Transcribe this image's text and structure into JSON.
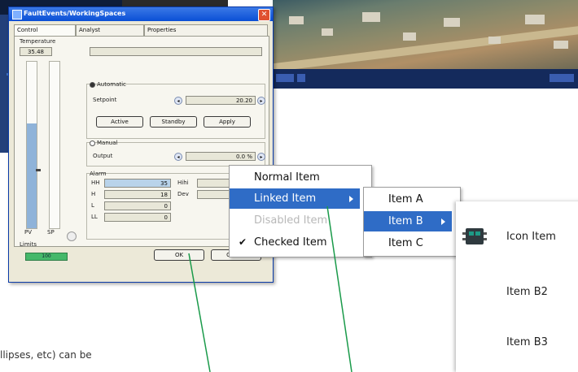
{
  "dialog": {
    "title": "FaultEvents/WorkingSpaces",
    "close_glyph": "✕",
    "tabs": [
      {
        "label": "Control"
      },
      {
        "label": "Analyst"
      },
      {
        "label": "Properties"
      }
    ],
    "temperature": {
      "label": "Temperature",
      "value": "35.48"
    },
    "automatic": {
      "label": "Automatic",
      "setpoint_label": "Setpoint",
      "setpoint_value": "20.20",
      "buttons": [
        "Active",
        "Standby",
        "Apply"
      ]
    },
    "manual": {
      "label": "Manual",
      "output_label": "Output",
      "output_value": "0.0 %"
    },
    "alarm": {
      "label": "Alarm",
      "rows": [
        {
          "label": "HH",
          "value": "35"
        },
        {
          "label": "H",
          "value": "18"
        },
        {
          "label": "L",
          "value": "0"
        },
        {
          "label": "LL",
          "value": "0"
        }
      ],
      "right_rows": [
        {
          "label": "Hihi"
        },
        {
          "label": "Dev"
        }
      ]
    },
    "gauge": {
      "pv_label": "PV",
      "sp_label": "SP",
      "pv_fill_fraction": 0.63
    },
    "limits": {
      "label": "Limits",
      "value": "100"
    },
    "ok_label": "OK",
    "cancel_label": "Cancel"
  },
  "context_menu": {
    "items": [
      {
        "label": "Normal Item"
      },
      {
        "label": "Linked Item"
      },
      {
        "label": "Disabled Item"
      },
      {
        "label": "Checked Item",
        "check": "✔"
      }
    ]
  },
  "submenu": {
    "items": [
      {
        "label": "Item A"
      },
      {
        "label": "Item B"
      },
      {
        "label": "Item C"
      }
    ]
  },
  "submenu2": {
    "items": [
      {
        "label": "Icon Item"
      },
      {
        "label": "Item B2"
      },
      {
        "label": "Item B3"
      }
    ]
  },
  "caption_fragment": "llipses, etc) can be",
  "colors": {
    "menu_highlight": "#2f6cc6",
    "callout_line": "#1a9a4a",
    "title_bar": "#0a4fd6"
  }
}
